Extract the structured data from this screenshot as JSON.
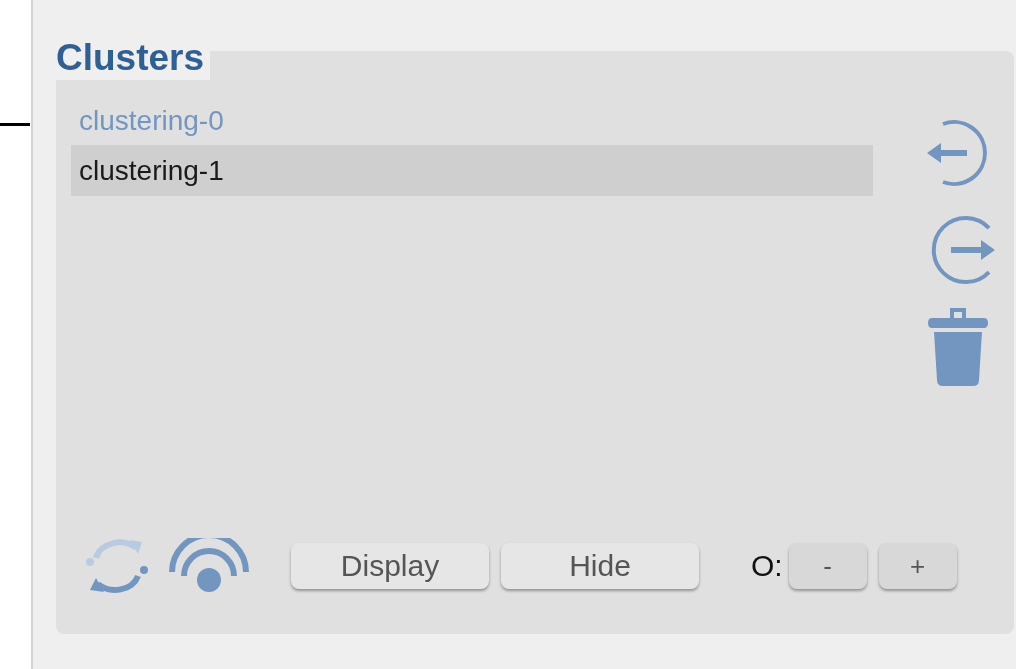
{
  "panel": {
    "title": "Clusters"
  },
  "clusters": [
    {
      "label": "clustering-0",
      "selected": false
    },
    {
      "label": "clustering-1",
      "selected": true
    }
  ],
  "buttons": [
    {
      "label": "Display"
    },
    {
      "label": "Hide"
    }
  ],
  "opacity": {
    "label": "O:",
    "decrease": "-",
    "increase": "+"
  }
}
